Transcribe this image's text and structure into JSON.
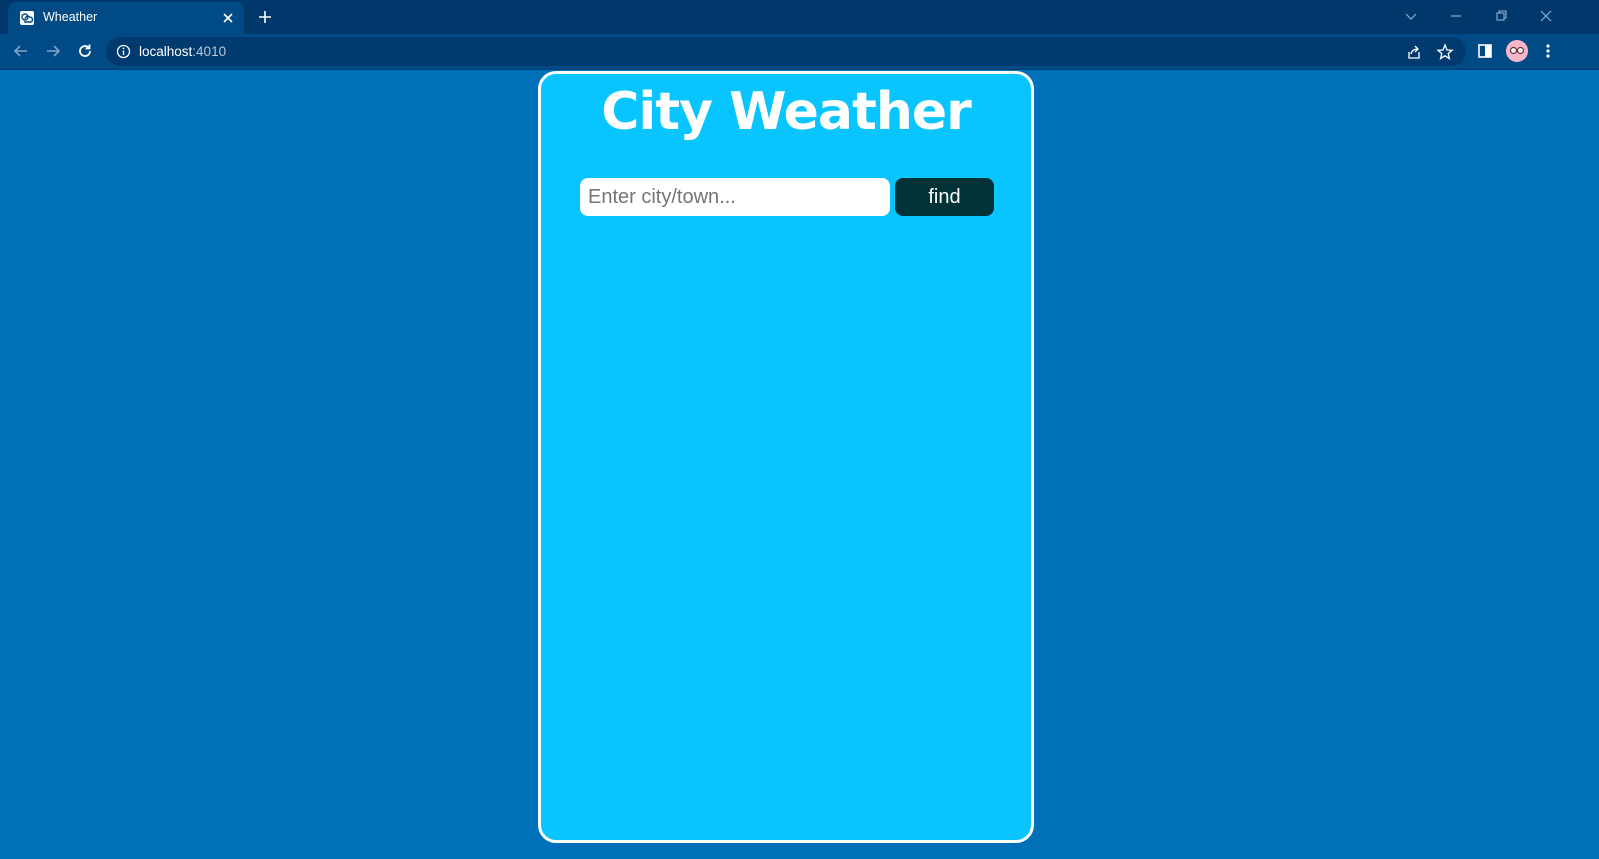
{
  "browser": {
    "tab_title": "Wheather",
    "url_host": "localhost",
    "url_port": ":4010"
  },
  "app": {
    "title": "City Weather",
    "search_placeholder": "Enter city/town...",
    "find_label": "find"
  },
  "colors": {
    "page_background": "#0070b8",
    "card_background": "#08c4ff",
    "card_border": "#ffffff",
    "button_background": "#013238",
    "chrome_dark": "#00386b",
    "chrome_toolbar": "#004a85"
  }
}
